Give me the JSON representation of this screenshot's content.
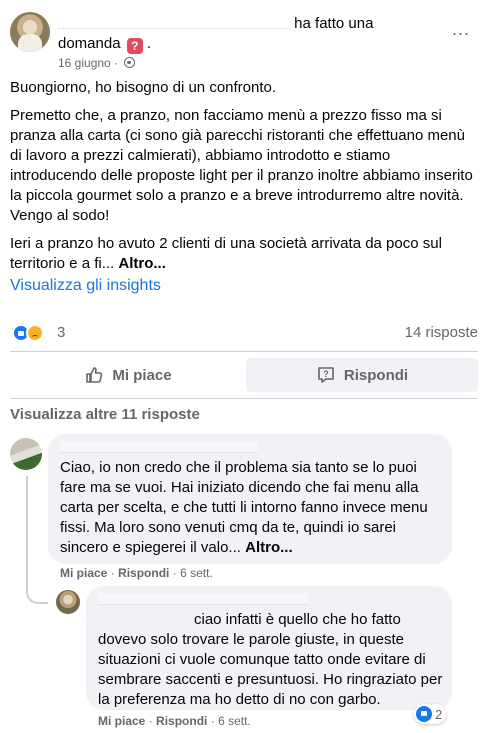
{
  "post": {
    "author_action": "ha fatto una",
    "post_type": "domanda",
    "question_icon": "?",
    "date": "16 giugno",
    "date_separator": "·",
    "more_icon": "...",
    "paragraphs": [
      "Buongiorno, ho bisogno di un confronto.",
      "Premetto che, a pranzo, non facciamo menù a prezzo fisso ma si pranza alla carta (ci sono già parecchi ristoranti che effettuano menù di lavoro a prezzi calmierati), abbiamo introdotto e stiamo introducendo delle proposte light per il pranzo inoltre abbiamo inserito la piccola gourmet solo a pranzo e a breve introdurremo altre novità. Vengo al sodo!",
      "Ieri a pranzo ho avuto 2 clienti di una società arrivata da poco sul territorio e a fi..."
    ],
    "see_more": "Altro...",
    "insights_link": "Visualizza gli insights",
    "reaction_count": "3",
    "answers_count": "14 risposte"
  },
  "actions": {
    "like_label": "Mi piace",
    "reply_label": "Rispondi"
  },
  "comments": {
    "more_replies": "Visualizza altre 11 risposte",
    "c1": {
      "text": "Ciao, io non credo che il problema sia tanto se lo puoi fare ma se vuoi. Hai iniziato dicendo che fai menu alla carta per scelta, e che tutti li intorno fanno invece menu fissi. Ma loro sono venuti cmq da te, quindi io sarei sincero e spiegerei il valo...",
      "see_more": "Altro...",
      "like": "Mi piace",
      "reply": "Rispondi",
      "time": "6 sett.",
      "sep": "·"
    },
    "c2": {
      "text": "ciao infatti è quello che ho fatto dovevo solo trovare le parole giuste, in queste situazioni ci vuole comunque tatto onde evitare di sembrare saccenti e presuntuosi. Ho ringraziato per la preferenza ma ho detto di no con garbo.",
      "like": "Mi piace",
      "reply": "Rispondi",
      "time": "6 sett.",
      "sep": "·",
      "reaction_count": "2"
    }
  }
}
